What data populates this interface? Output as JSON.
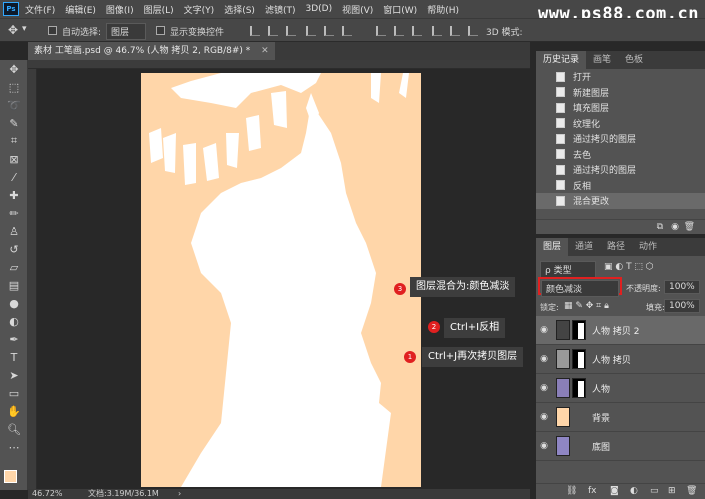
{
  "menubar": {
    "logo": "Ps",
    "items": [
      "文件(F)",
      "编辑(E)",
      "图像(I)",
      "图层(L)",
      "文字(Y)",
      "选择(S)",
      "滤镜(T)",
      "3D(D)",
      "视图(V)",
      "窗口(W)",
      "帮助(H)"
    ]
  },
  "watermark": "www.ps88.com.cn",
  "options": {
    "auto_select_label": "自动选择:",
    "auto_select_value": "图层",
    "show_transform_label": "显示变换控件",
    "mode_3d_label": "3D 模式:"
  },
  "document": {
    "tab_title": "素材 工笔画.psd @ 46.7% (人物 拷贝 2, RGB/8#) *",
    "zoom": "46.72%",
    "doc_info": "文档:3.19M/36.1M"
  },
  "history": {
    "tabs": [
      "历史记录",
      "画笔",
      "色板"
    ],
    "items": [
      "打开",
      "新建图层",
      "填充图层",
      "纹理化",
      "通过拷贝的图层",
      "去色",
      "通过拷贝的图层",
      "反相",
      "混合更改"
    ],
    "selected_index": 8
  },
  "layers": {
    "tabs": [
      "图层",
      "通道",
      "路径",
      "动作"
    ],
    "filter_label": "ρ 类型",
    "blend_mode": "颜色减淡",
    "opacity_label": "不透明度:",
    "opacity_value": "100%",
    "lock_label": "锁定:",
    "fill_label": "填充:",
    "fill_value": "100%",
    "items": [
      {
        "name": "人物 拷贝 2",
        "selected": true
      },
      {
        "name": "人物 拷贝",
        "selected": false
      },
      {
        "name": "人物",
        "selected": false
      },
      {
        "name": "背景",
        "selected": false
      },
      {
        "name": "底图",
        "selected": false
      }
    ]
  },
  "annotations": [
    {
      "num": "1",
      "text": "Ctrl+J再次拷贝图层"
    },
    {
      "num": "2",
      "text": "Ctrl+I反相"
    },
    {
      "num": "3",
      "text": "图层混合为:颜色减淡"
    }
  ],
  "colors": {
    "canvas_bg": "#ffd6a9",
    "highlight_box": "#e02020",
    "foreground_swatch": "#ffd6a9"
  }
}
